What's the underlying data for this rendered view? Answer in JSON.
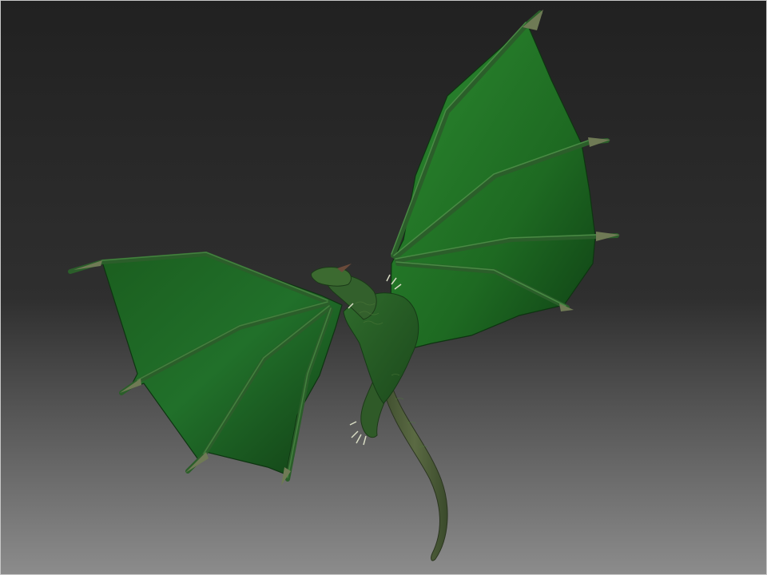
{
  "viewport": {
    "background_top": "#212121",
    "background_mid": "#2f2f2f",
    "background_bottom": "#8c8c8c",
    "border_color": "#c8c8c8"
  },
  "model": {
    "subject": "dragon-render",
    "membrane_color": "#1e6a22",
    "membrane_light": "#2c8a30",
    "membrane_dark": "#0f3f14",
    "bone_color": "#2d5a2c",
    "claw_color": "#6f7a55",
    "body_color": "#3d5a2a",
    "tail_color": "#54613d"
  }
}
